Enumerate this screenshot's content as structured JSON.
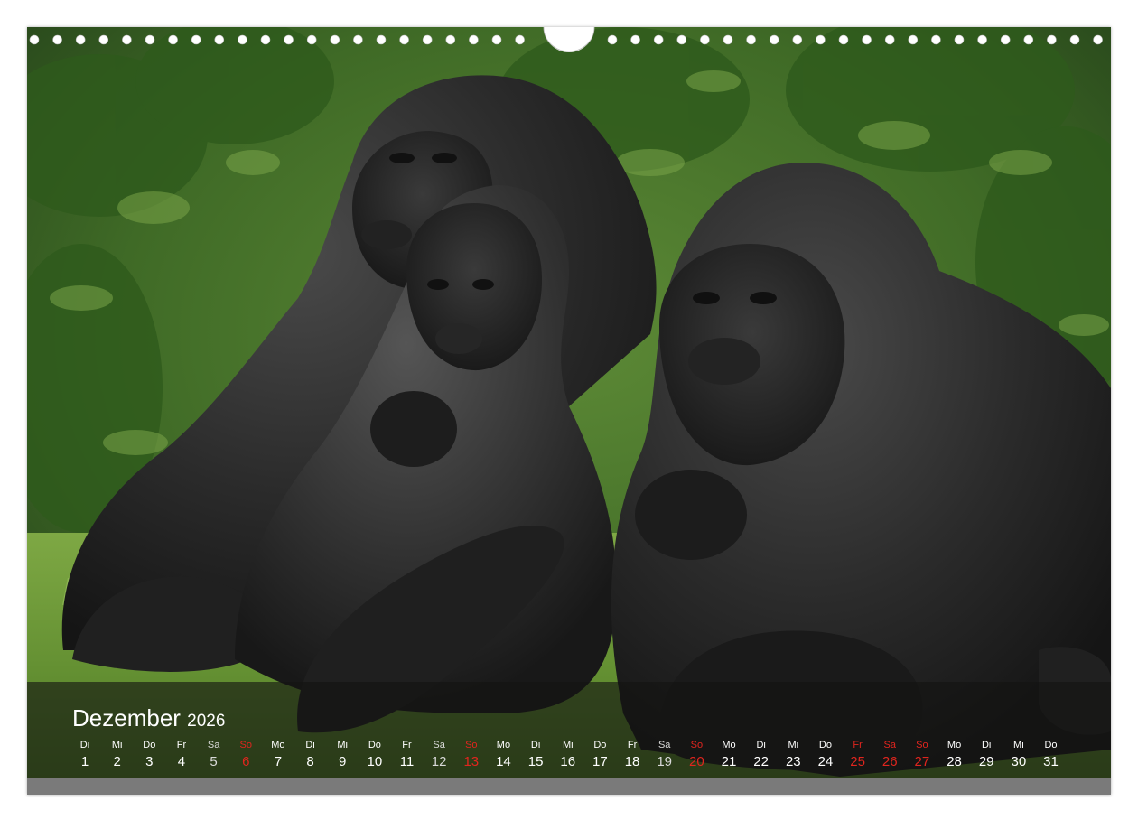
{
  "calendar": {
    "month": "Dezember",
    "year": "2026",
    "days": [
      {
        "wd": "Di",
        "d": "1",
        "type": "normal"
      },
      {
        "wd": "Mi",
        "d": "2",
        "type": "normal"
      },
      {
        "wd": "Do",
        "d": "3",
        "type": "normal"
      },
      {
        "wd": "Fr",
        "d": "4",
        "type": "normal"
      },
      {
        "wd": "Sa",
        "d": "5",
        "type": "weekend"
      },
      {
        "wd": "So",
        "d": "6",
        "type": "red"
      },
      {
        "wd": "Mo",
        "d": "7",
        "type": "normal"
      },
      {
        "wd": "Di",
        "d": "8",
        "type": "normal"
      },
      {
        "wd": "Mi",
        "d": "9",
        "type": "normal"
      },
      {
        "wd": "Do",
        "d": "10",
        "type": "normal"
      },
      {
        "wd": "Fr",
        "d": "11",
        "type": "normal"
      },
      {
        "wd": "Sa",
        "d": "12",
        "type": "weekend"
      },
      {
        "wd": "So",
        "d": "13",
        "type": "red"
      },
      {
        "wd": "Mo",
        "d": "14",
        "type": "normal"
      },
      {
        "wd": "Di",
        "d": "15",
        "type": "normal"
      },
      {
        "wd": "Mi",
        "d": "16",
        "type": "normal"
      },
      {
        "wd": "Do",
        "d": "17",
        "type": "normal"
      },
      {
        "wd": "Fr",
        "d": "18",
        "type": "normal"
      },
      {
        "wd": "Sa",
        "d": "19",
        "type": "weekend"
      },
      {
        "wd": "So",
        "d": "20",
        "type": "red"
      },
      {
        "wd": "Mo",
        "d": "21",
        "type": "normal"
      },
      {
        "wd": "Di",
        "d": "22",
        "type": "normal"
      },
      {
        "wd": "Mi",
        "d": "23",
        "type": "normal"
      },
      {
        "wd": "Do",
        "d": "24",
        "type": "normal"
      },
      {
        "wd": "Fr",
        "d": "25",
        "type": "red"
      },
      {
        "wd": "Sa",
        "d": "26",
        "type": "red"
      },
      {
        "wd": "So",
        "d": "27",
        "type": "red"
      },
      {
        "wd": "Mo",
        "d": "28",
        "type": "normal"
      },
      {
        "wd": "Di",
        "d": "29",
        "type": "normal"
      },
      {
        "wd": "Mi",
        "d": "30",
        "type": "normal"
      },
      {
        "wd": "Do",
        "d": "31",
        "type": "normal"
      }
    ]
  },
  "colors": {
    "holiday_red": "#e0251e",
    "band": "#141412",
    "strip": "#7a7a7a",
    "grass": "#5f8a2c",
    "foliage": "#3e6a24",
    "gorilla": "#2a2a2a"
  }
}
